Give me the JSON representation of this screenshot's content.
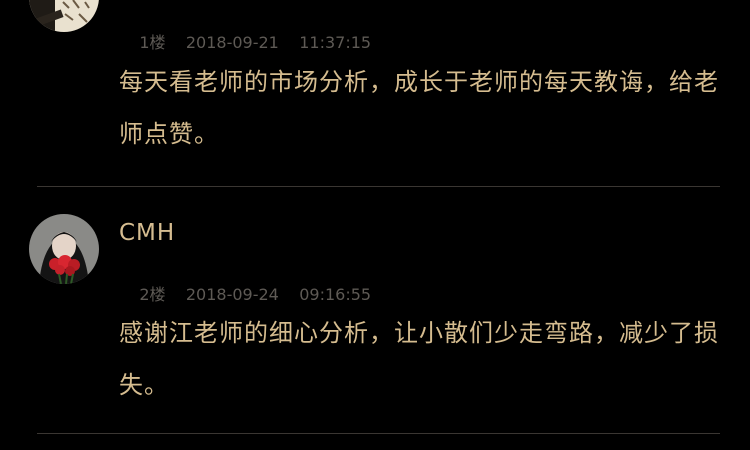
{
  "comments": [
    {
      "floor": "1楼",
      "date": "2018-09-21",
      "time": "11:37:15",
      "text": "每天看老师的市场分析，成长于老师的每天教诲，给老师点赞。"
    },
    {
      "name": "CMH",
      "floor": "2楼",
      "date": "2018-09-24",
      "time": "09:16:55",
      "text": "感谢江老师的细心分析，让小散们少走弯路，减少了损失。"
    }
  ]
}
